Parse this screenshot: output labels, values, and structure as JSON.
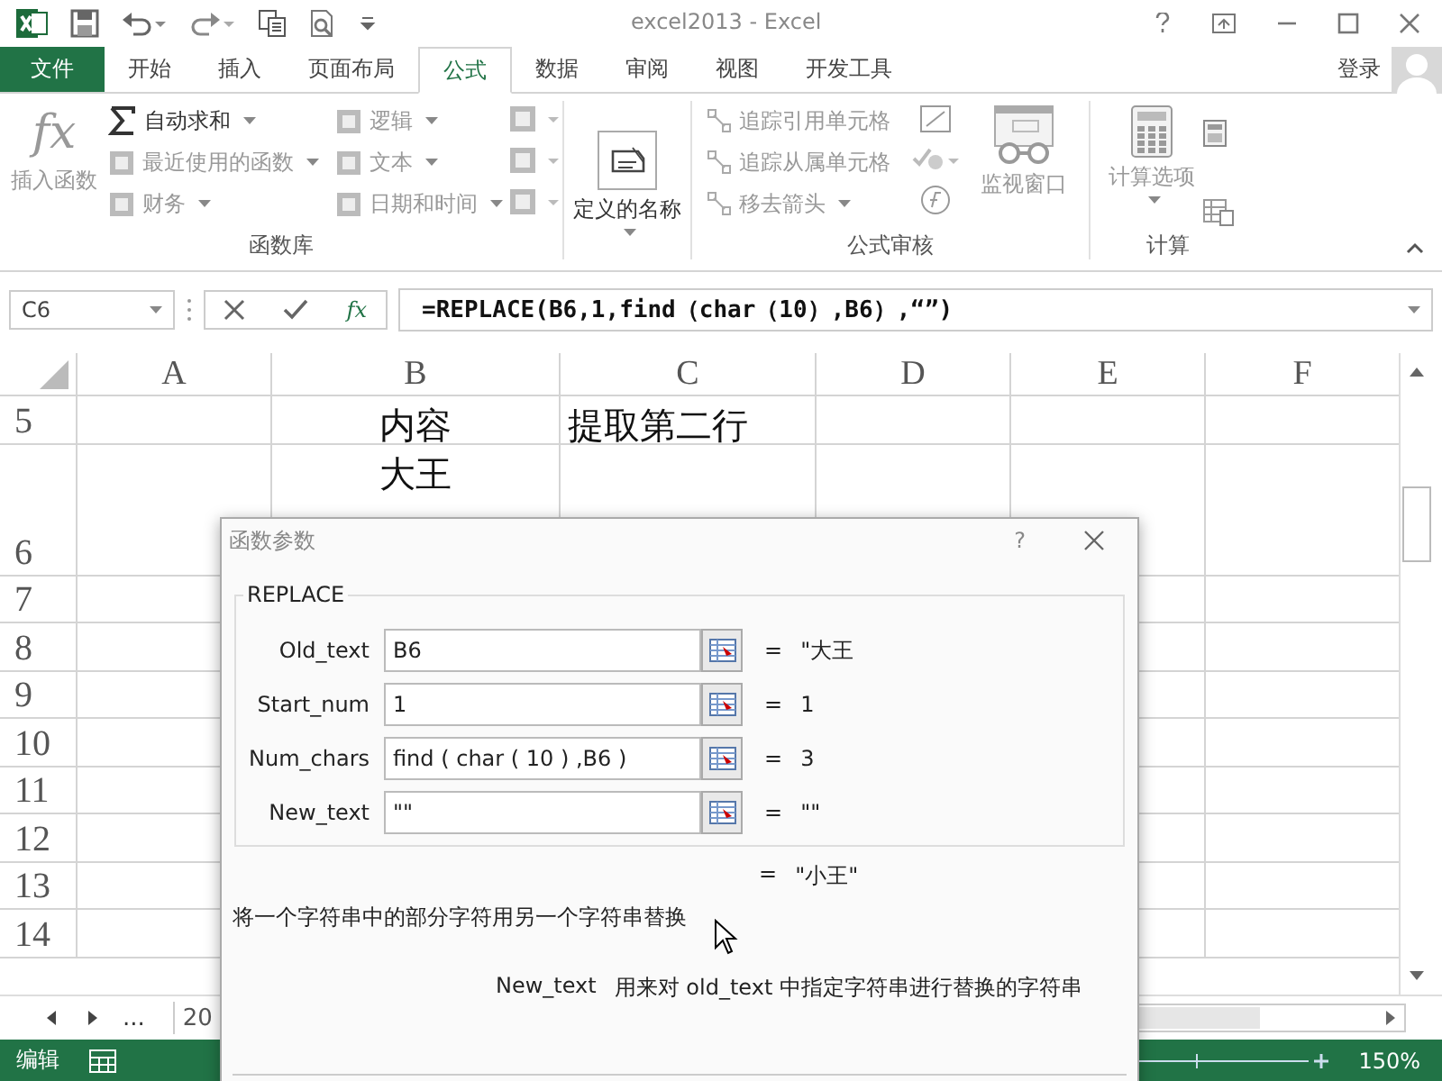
{
  "window": {
    "title": "excel2013 - Excel"
  },
  "tabs": [
    {
      "label": "文件",
      "kind": "file",
      "selected": false
    },
    {
      "label": "开始",
      "kind": "tab",
      "selected": false
    },
    {
      "label": "插入",
      "kind": "tab",
      "selected": false
    },
    {
      "label": "页面布局",
      "kind": "tab",
      "selected": false
    },
    {
      "label": "公式",
      "kind": "tab",
      "selected": true
    },
    {
      "label": "数据",
      "kind": "tab",
      "selected": false
    },
    {
      "label": "审阅",
      "kind": "tab",
      "selected": false
    },
    {
      "label": "视图",
      "kind": "tab",
      "selected": false
    },
    {
      "label": "开发工具",
      "kind": "tab",
      "selected": false
    }
  ],
  "account": {
    "label": "登录"
  },
  "ribbon": {
    "function_library": {
      "label": "函数库",
      "insert_function": {
        "symbol": "fx",
        "label": "插入函数",
        "disabled": true
      },
      "column_1": [
        {
          "label": "自动求和",
          "disabled": false
        },
        {
          "label": "最近使用的函数",
          "disabled": true
        },
        {
          "label": "财务",
          "disabled": true
        }
      ],
      "column_2": [
        {
          "label": "逻辑",
          "disabled": true
        },
        {
          "label": "文本",
          "disabled": true
        },
        {
          "label": "日期和时间",
          "disabled": true
        }
      ]
    },
    "defined_names": {
      "label": "定义的名称",
      "disabled": false
    },
    "formula_auditing": {
      "label": "公式审核",
      "items": [
        {
          "label": "追踪引用单元格",
          "disabled": true
        },
        {
          "label": "追踪从属单元格",
          "disabled": true
        },
        {
          "label": "移去箭头",
          "disabled": true
        }
      ],
      "watch_window": {
        "label": "监视窗口",
        "disabled": true
      }
    },
    "calculation": {
      "label": "计算",
      "options": {
        "label": "计算选项",
        "disabled": true
      }
    }
  },
  "formula_bar": {
    "name_box": "C6",
    "insert_function_symbol": "fx",
    "formula": "=REPLACE(B6,1,find（char（10）,B6）,“”)"
  },
  "sheet": {
    "columns": [
      "A",
      "B",
      "C",
      "D",
      "E",
      "F"
    ],
    "rows": [
      {
        "number": "5",
        "B": "内容",
        "C": "提取第二行"
      },
      {
        "number": "6",
        "B": "大王"
      },
      {
        "number": "7"
      },
      {
        "number": "8"
      },
      {
        "number": "9"
      },
      {
        "number": "10"
      },
      {
        "number": "11"
      },
      {
        "number": "12"
      },
      {
        "number": "13"
      },
      {
        "number": "14"
      }
    ]
  },
  "sheet_tabs": {
    "more": "...",
    "tab": "20"
  },
  "status_bar": {
    "mode": "编辑",
    "zoom": "150%"
  },
  "dialog": {
    "title": "函数参数",
    "help": "?",
    "function": "REPLACE",
    "arguments": [
      {
        "name": "Old_text",
        "value": "B6",
        "equals": "=",
        "result": "\"大王"
      },
      {
        "name": "Start_num",
        "value": "1",
        "equals": "=",
        "result": "1"
      },
      {
        "name": "Num_chars",
        "value": "find ( char ( 10 ) ,B6 )",
        "equals": "=",
        "result": "3"
      },
      {
        "name": "New_text",
        "value": "\"\"",
        "equals": "=",
        "result": "\"\""
      }
    ],
    "result_equals": "=",
    "result": "\"小王\"",
    "description": "将一个字符串中的部分字符用另一个字符串替换",
    "argument_help": {
      "name": "New_text",
      "text": "用来对 old_text 中指定字符串进行替换的字符串"
    }
  }
}
